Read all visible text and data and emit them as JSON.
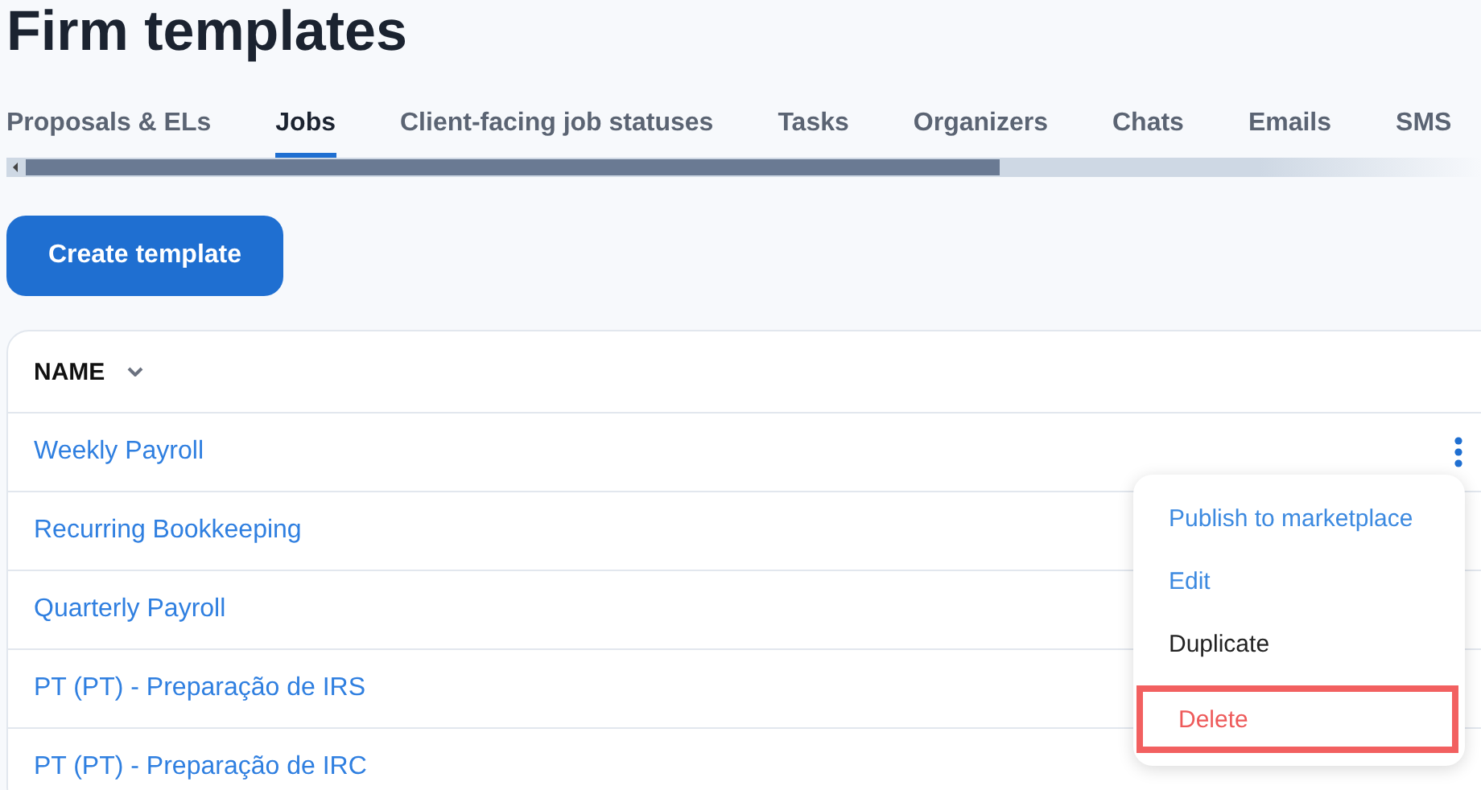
{
  "page": {
    "title": "Firm templates"
  },
  "tabs": [
    {
      "label": "Proposals & ELs",
      "selected": false
    },
    {
      "label": "Jobs",
      "selected": true
    },
    {
      "label": "Client-facing job statuses",
      "selected": false
    },
    {
      "label": "Tasks",
      "selected": false
    },
    {
      "label": "Organizers",
      "selected": false
    },
    {
      "label": "Chats",
      "selected": false
    },
    {
      "label": "Emails",
      "selected": false
    },
    {
      "label": "SMS",
      "selected": false
    }
  ],
  "create_button": "Create template",
  "table": {
    "columns": [
      {
        "label": "NAME",
        "sorted": true
      }
    ],
    "rows": [
      {
        "name": "Weekly Payroll",
        "menu_open": true
      },
      {
        "name": "Recurring Bookkeeping",
        "menu_open": false
      },
      {
        "name": "Quarterly Payroll",
        "menu_open": false
      },
      {
        "name": "PT (PT) - Preparação de IRS",
        "menu_open": false
      },
      {
        "name": "PT (PT) - Preparação de IRC",
        "menu_open": false
      }
    ]
  },
  "row_menu": {
    "items": [
      {
        "label": "Publish to marketplace",
        "kind": "link",
        "highlighted": false
      },
      {
        "label": "Edit",
        "kind": "link",
        "highlighted": false
      },
      {
        "label": "Duplicate",
        "kind": "plain",
        "highlighted": false
      },
      {
        "label": "Delete",
        "kind": "danger",
        "highlighted": true
      }
    ]
  }
}
